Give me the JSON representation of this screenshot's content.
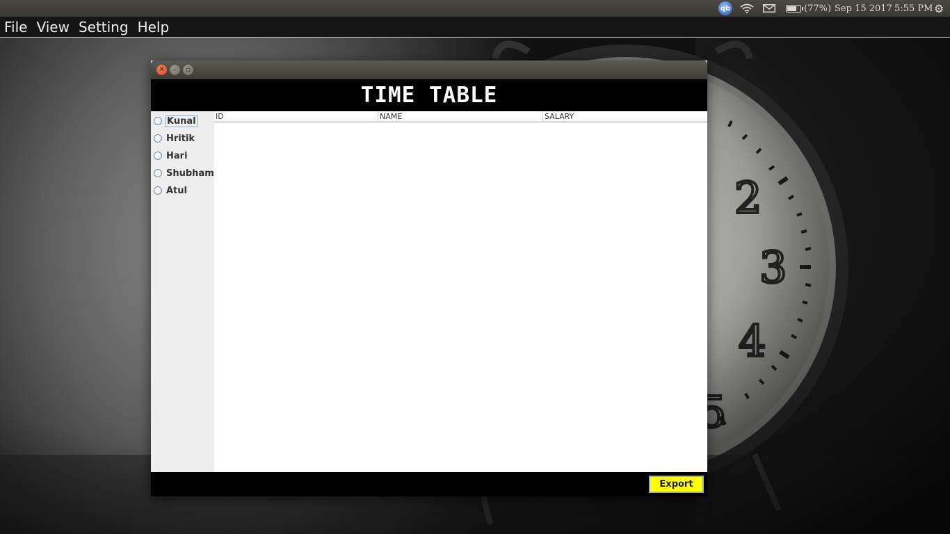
{
  "system_panel": {
    "user_icon_text": "qb",
    "battery_text": "(77%)",
    "battery_level": 0.77,
    "date": "Sep 15 2017",
    "time": "5:55 PM"
  },
  "menubar": {
    "items": [
      {
        "label": "File"
      },
      {
        "label": "View"
      },
      {
        "label": "Setting"
      },
      {
        "label": "Help"
      }
    ]
  },
  "window": {
    "header_title": "TIME TABLE",
    "sidebar": {
      "options": [
        {
          "label": "Kunal"
        },
        {
          "label": "Hritik"
        },
        {
          "label": "Hari"
        },
        {
          "label": "Shubham"
        },
        {
          "label": "Atul"
        }
      ]
    },
    "table": {
      "columns": [
        "ID",
        "NAME",
        "SALARY"
      ],
      "rows": []
    },
    "footer": {
      "export_label": "Export"
    }
  },
  "colors": {
    "export_button_bg": "#ffff00",
    "header_bg": "#000000",
    "close_button": "#e8572f"
  }
}
